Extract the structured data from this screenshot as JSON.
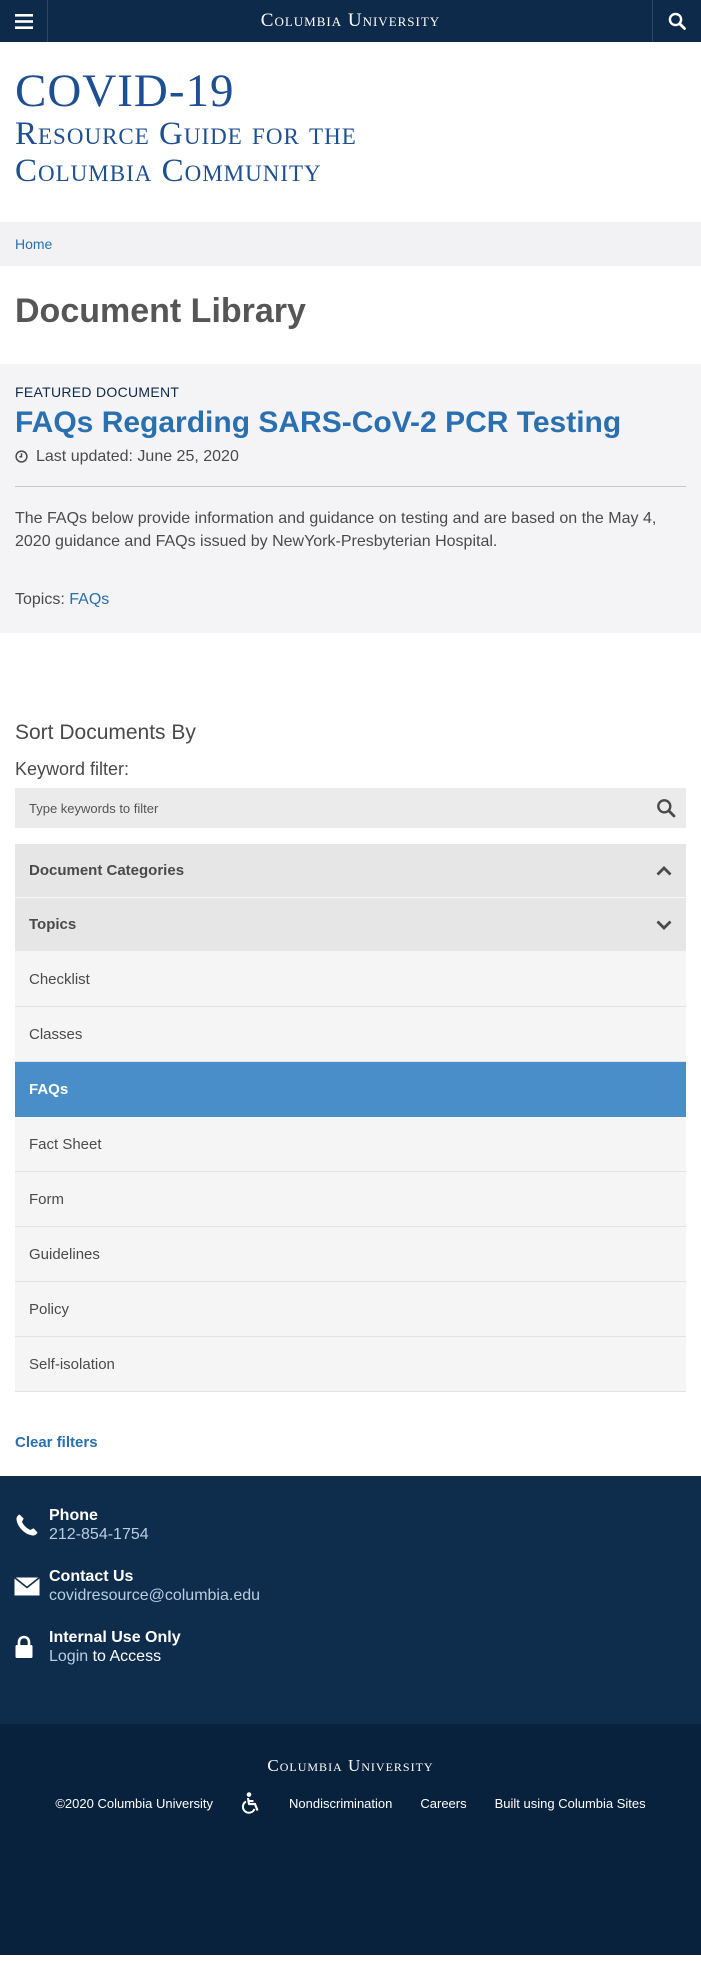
{
  "header": {
    "wordmark": "Columbia University",
    "menu_icon": "hamburger-menu-icon",
    "search_icon": "search-icon"
  },
  "hero": {
    "line1": "COVID-19",
    "line2": "Resource Guide for the",
    "line3": "Columbia Community"
  },
  "breadcrumb": {
    "home": "Home"
  },
  "page_title": "Document Library",
  "featured": {
    "kicker": "FEATURED DOCUMENT",
    "title": "FAQs Regarding SARS-CoV-2 PCR Testing",
    "updated": "Last updated: June 25, 2020",
    "description": "The FAQs below provide information and guidance on testing and are based on the May 4, 2020 guidance and FAQs issued by NewYork-Presbyterian Hospital.",
    "topics_label": "Topics:",
    "topics_link": "FAQs"
  },
  "sort": {
    "heading": "Sort Documents By",
    "keyword_label": "Keyword filter:",
    "search_placeholder": "Type keywords to filter",
    "categories_label": "Document Categories",
    "topics_label": "Topics",
    "topics": [
      "Checklist",
      "Classes",
      "FAQs",
      "Fact Sheet",
      "Form",
      "Guidelines",
      "Policy",
      "Self-isolation"
    ],
    "active_topic": "FAQs",
    "clear_filters": "Clear filters"
  },
  "footer": {
    "phone_title": "Phone",
    "phone_value": "212-854-1754",
    "contact_title": "Contact Us",
    "contact_value": "covidresource@columbia.edu",
    "internal_title": "Internal Use Only",
    "internal_login": "Login",
    "internal_rest": " to Access",
    "wordmark": "Columbia University",
    "copyright": "©2020 Columbia University",
    "nondiscrimination": "Nondiscrimination",
    "careers": "Careers",
    "built": "Built using Columbia Sites"
  },
  "colors": {
    "navy": "#0d2a4a",
    "title_blue": "#1d4f91",
    "link_blue": "#2a6fb0",
    "active_blue": "#4a8ec9"
  }
}
